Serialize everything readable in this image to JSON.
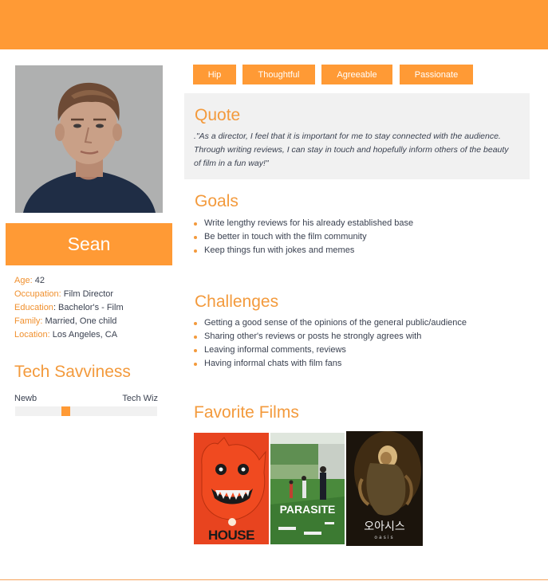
{
  "persona": {
    "name": "Sean",
    "facts": [
      {
        "key": "Age:",
        "value": " 42"
      },
      {
        "key": "Occupation:",
        "value": " Film Director"
      },
      {
        "key": "Education",
        "value": ": Bachelor's - Film"
      },
      {
        "key": "Family:",
        "value": " Married, One child"
      },
      {
        "key": "Location:",
        "value": " Los Angeles, CA"
      }
    ]
  },
  "tech_savviness": {
    "title": "Tech Savviness",
    "low_label": "Newb",
    "high_label": "Tech Wiz",
    "level_fraction": 0.35
  },
  "traits": [
    "Hip",
    "Thoughtful",
    "Agreeable",
    "Passionate"
  ],
  "quote": {
    "title": "Quote",
    "text": ".\"As a director, I feel that it is important for me to stay connected with the audience. Through writing reviews, I can stay in touch and hopefully inform others of the beauty of film in a fun way!\""
  },
  "goals": {
    "title": "Goals",
    "items": [
      "Write lengthy reviews for his already established base",
      "Be better in touch with the film community",
      "Keep things fun with jokes and memes"
    ]
  },
  "challenges": {
    "title": "Challenges",
    "items": [
      "Getting a good sense of the opinions of the general public/audience",
      "Sharing other's reviews or posts he strongly agrees with",
      "Leaving informal comments, reviews",
      "Having informal chats with film fans"
    ]
  },
  "films": {
    "title": "Favorite Films",
    "posters": [
      {
        "title_text": "HOUSE"
      },
      {
        "title_text": "PARASITE"
      },
      {
        "title_text": "오아시스",
        "subtitle_text": "oasis"
      }
    ]
  },
  "colors": {
    "accent": "#ff9a35",
    "heading": "#f39a3c",
    "panel": "#f1f1f1",
    "body_text": "#3a4150"
  }
}
